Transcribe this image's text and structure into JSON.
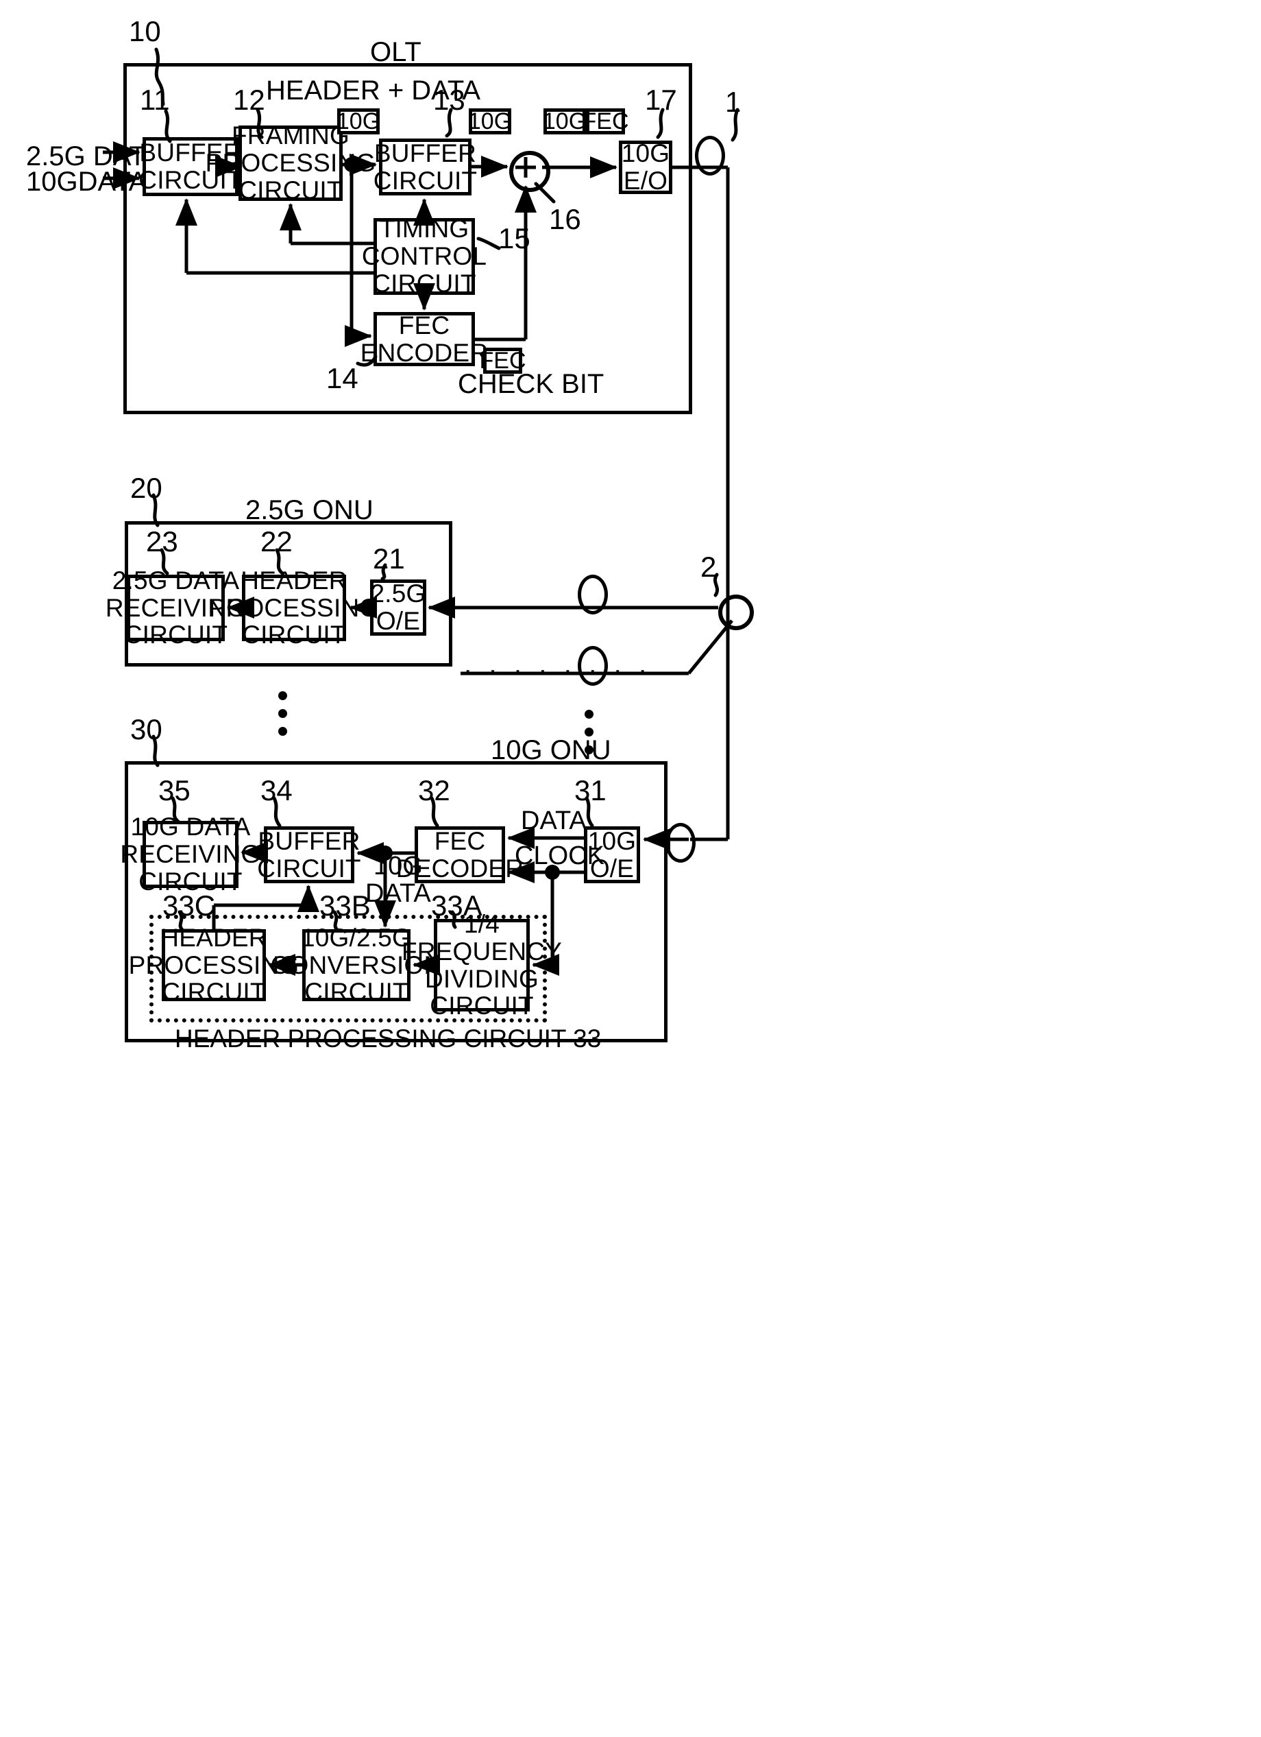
{
  "figure": {
    "type": "patent-block-diagram",
    "title_olt": "OLT",
    "title_onu_25g": "2.5G ONU",
    "title_onu_10g": "10G ONU"
  },
  "olt": {
    "ref": "10",
    "inputs": [
      {
        "label": "2.5G DATA"
      },
      {
        "label": "10GDATA"
      }
    ],
    "annotations": {
      "header_data": "HEADER + DATA",
      "check_bit": "CHECK BIT"
    },
    "tags": {
      "tag_10g_a": "10G",
      "tag_10g_b": "10G",
      "tag_10g_c": "10G",
      "tag_fec_top": "FEC",
      "tag_fec_bottom": "FEC"
    },
    "blocks": [
      {
        "ref": "11",
        "label": "BUFFER\nCIRCUIT"
      },
      {
        "ref": "12",
        "label": "FRAMING\nPROCESSING\nCIRCUIT"
      },
      {
        "ref": "13",
        "label": "BUFFER\nCIRCUIT"
      },
      {
        "ref": "15",
        "label": "TIMING\nCONTROL\nCIRCUIT"
      },
      {
        "ref": "14",
        "label": "FEC\nENCODER"
      },
      {
        "ref": "17",
        "label": "10G\nE/O"
      }
    ],
    "adder": {
      "ref": "16",
      "symbol": "+"
    }
  },
  "fiber": {
    "trunk_ref": "1",
    "splitter_ref": "2"
  },
  "onu_25g": {
    "ref": "20",
    "blocks": [
      {
        "ref": "23",
        "label": "2.5G DATA\nRECEIVING\nCIRCUIT"
      },
      {
        "ref": "22",
        "label": "HEADER\nPROCESSING\nCIRCUIT"
      },
      {
        "ref": "21",
        "label": "2.5G\nO/E"
      }
    ]
  },
  "onu_10g": {
    "ref": "30",
    "blocks": [
      {
        "ref": "35",
        "label": "10G DATA\nRECEIVING\nCIRCUIT"
      },
      {
        "ref": "34",
        "label": "BUFFER\nCIRCUIT"
      },
      {
        "ref": "32",
        "label": "FEC\nDECODER"
      },
      {
        "ref": "31",
        "label": "10G\nO/E"
      },
      {
        "ref": "33C",
        "label": "HEADER\nPROCESSING\nCIRCUIT"
      },
      {
        "ref": "33B",
        "label": "10G/2.5G\nCONVERSION\nCIRCUIT"
      },
      {
        "ref": "33A",
        "label": "1/4\nFREQUENCY\nDIVIDING\nCIRCUIT"
      }
    ],
    "signal_labels": {
      "tenG_data": "10G\nDATA",
      "data": "DATA",
      "clock": "CLOCK"
    },
    "group_caption": "HEADER PROCESSING CIRCUIT 33"
  },
  "colors": {
    "ink": "#000000",
    "paper": "#ffffff"
  }
}
